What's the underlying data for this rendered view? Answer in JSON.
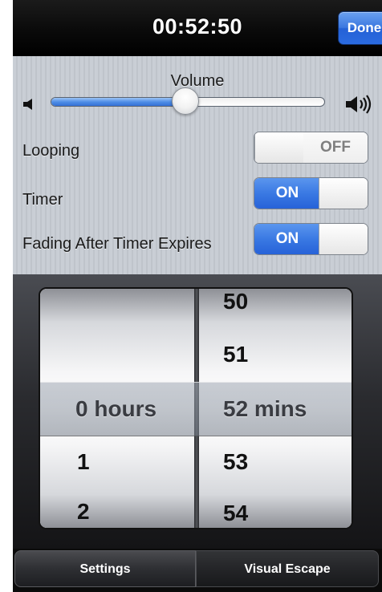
{
  "header": {
    "title": "00:52:50",
    "done_label": "Done"
  },
  "settings": {
    "volume_label": "Volume",
    "volume_level": 0.49,
    "looping": {
      "label": "Looping",
      "state": "OFF"
    },
    "timer": {
      "label": "Timer",
      "state": "ON"
    },
    "fading": {
      "label": "Fading After Timer Expires",
      "state": "ON"
    }
  },
  "picker": {
    "hours": {
      "selected": "0 hours",
      "below": [
        "1",
        "2"
      ]
    },
    "minutes": {
      "above": [
        "50",
        "51"
      ],
      "selected": "52 mins",
      "below": [
        "53",
        "54"
      ]
    }
  },
  "tabs": {
    "settings_label": "Settings",
    "visual_escape_label": "Visual Escape"
  },
  "colors": {
    "accent_blue": "#3a79e3",
    "toolbar_black": "#0a0a0a",
    "panel_gray": "#c6cbd2"
  }
}
